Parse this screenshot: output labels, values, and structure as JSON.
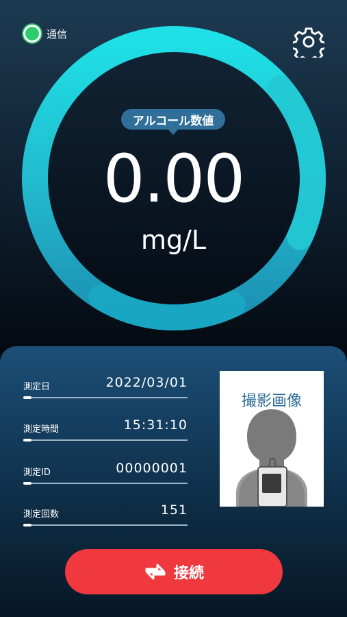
{
  "status": {
    "label": "通信",
    "color": "#2ecc71"
  },
  "gauge": {
    "badge": "アルコール数値",
    "value": "0.00",
    "unit": "mg/L",
    "level": 0.0
  },
  "measurement": {
    "rows": [
      {
        "label": "測定日",
        "value": "2022/03/01"
      },
      {
        "label": "測定時間",
        "value": "15:31:10"
      },
      {
        "label": "測定ID",
        "value": "00000001"
      },
      {
        "label": "測定回数",
        "value": "151"
      }
    ]
  },
  "photo": {
    "label": "撮影画像"
  },
  "connect": {
    "label": "接続",
    "color": "#f0383f"
  },
  "icons": {
    "settings": "gear-icon",
    "connect": "swap-arrows-icon"
  }
}
